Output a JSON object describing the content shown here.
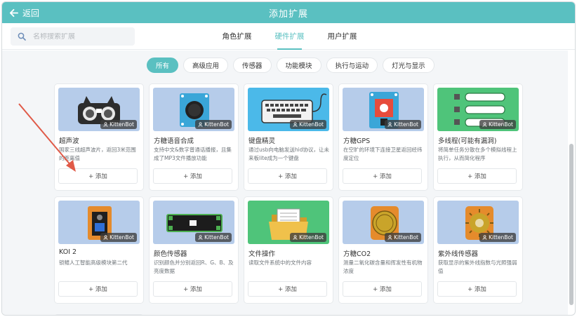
{
  "header": {
    "back_label": "返回",
    "title": "添加扩展"
  },
  "search": {
    "placeholder": "名称搜索扩展"
  },
  "tabs": [
    {
      "label": "角色扩展",
      "active": false
    },
    {
      "label": "硬件扩展",
      "active": true
    },
    {
      "label": "用户扩展",
      "active": false
    }
  ],
  "filters": [
    {
      "label": "所有",
      "active": true
    },
    {
      "label": "高级应用",
      "active": false
    },
    {
      "label": "传感器",
      "active": false
    },
    {
      "label": "功能模块",
      "active": false
    },
    {
      "label": "执行与运动",
      "active": false
    },
    {
      "label": "灯光与显示",
      "active": false
    }
  ],
  "add_label": "+ 添加",
  "badge_label": "KittenBot",
  "cards": [
    {
      "name": "超声波",
      "desc": "国家三线超声波片，返回3米范围的距离值",
      "bg": "#b6ccea",
      "icon": "ultrasonic-sensor-icon"
    },
    {
      "name": "方糖语音合成",
      "desc": "支持中文&数字普通话播报，且集成了MP3文件播放功能",
      "bg": "#b6ccea",
      "icon": "speaker-module-icon"
    },
    {
      "name": "键盘精灵",
      "desc": "通过usb向电脑发送hid协议，让未来板lite成为一个键盘",
      "bg": "#4bb9e9",
      "icon": "keyboard-icon"
    },
    {
      "name": "方糖GPS",
      "desc": "在空旷的环境下连接卫星返回经纬度定位",
      "bg": "#b6ccea",
      "icon": "gps-module-icon"
    },
    {
      "name": "多线程(可能有漏洞)",
      "desc": "将简单任务分散在多个模拟线程上执行，从而简化程序",
      "bg": "#4fc47a",
      "icon": "threads-icon"
    },
    {
      "name": "KOI 2",
      "desc": "锁鳍人工智能高级模块第二代",
      "bg": "#b6ccea",
      "icon": "koi-camera-icon"
    },
    {
      "name": "颜色传感器",
      "desc": "识别颜色并分别返回R、G、B、及亮度数据",
      "bg": "#b6ccea",
      "icon": "color-sensor-icon"
    },
    {
      "name": "文件操作",
      "desc": "读取文件系统中的文件内容",
      "bg": "#4fc47a",
      "icon": "folder-icon"
    },
    {
      "name": "方糖CO2",
      "desc": "测量二氧化碳含量和挥发性有机物浓度",
      "bg": "#b6ccea",
      "icon": "co2-sensor-icon"
    },
    {
      "name": "紫外线传感器",
      "desc": "获取显示的紫外线指数与光照强弱值",
      "bg": "#b6ccea",
      "icon": "uv-sensor-icon"
    }
  ],
  "colors": {
    "accent": "#5ac0c1",
    "annotation_arrow": "#e05a48"
  }
}
